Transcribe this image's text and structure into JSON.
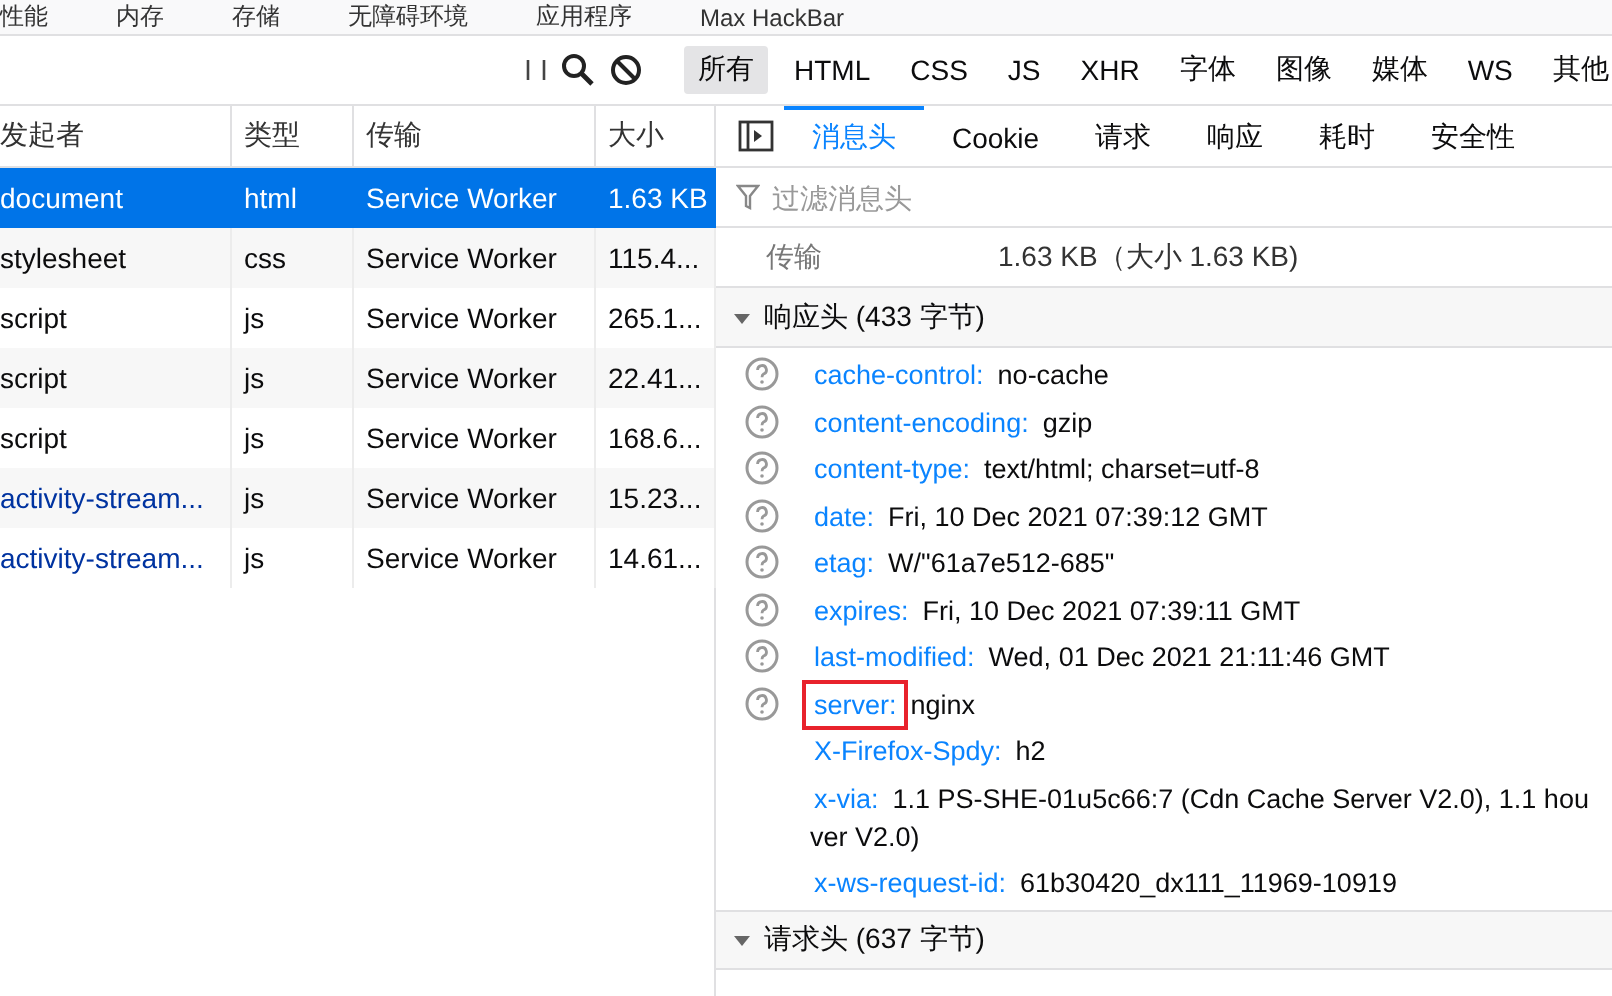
{
  "top_tabs": [
    "性能",
    "内存",
    "存储",
    "无障碍环境",
    "应用程序",
    "Max HackBar"
  ],
  "filter_types": [
    {
      "label": "所有",
      "selected": true
    },
    {
      "label": "HTML",
      "selected": false
    },
    {
      "label": "CSS",
      "selected": false
    },
    {
      "label": "JS",
      "selected": false
    },
    {
      "label": "XHR",
      "selected": false
    },
    {
      "label": "字体",
      "selected": false
    },
    {
      "label": "图像",
      "selected": false
    },
    {
      "label": "媒体",
      "selected": false
    },
    {
      "label": "WS",
      "selected": false
    },
    {
      "label": "其他",
      "selected": false
    }
  ],
  "table": {
    "columns": [
      "发起者",
      "类型",
      "传输",
      "大小"
    ],
    "rows": [
      {
        "cells": [
          "document",
          "html",
          "Service Worker",
          "1.63 KB"
        ],
        "selected": true,
        "link": false
      },
      {
        "cells": [
          "stylesheet",
          "css",
          "Service Worker",
          "115.4..."
        ],
        "selected": false,
        "link": false
      },
      {
        "cells": [
          "script",
          "js",
          "Service Worker",
          "265.1..."
        ],
        "selected": false,
        "link": false
      },
      {
        "cells": [
          "script",
          "js",
          "Service Worker",
          "22.41..."
        ],
        "selected": false,
        "link": false
      },
      {
        "cells": [
          "script",
          "js",
          "Service Worker",
          "168.6..."
        ],
        "selected": false,
        "link": false
      },
      {
        "cells": [
          "activity-stream...",
          "js",
          "Service Worker",
          "15.23..."
        ],
        "selected": false,
        "link": true
      },
      {
        "cells": [
          "activity-stream...",
          "js",
          "Service Worker",
          "14.61..."
        ],
        "selected": false,
        "link": true
      }
    ]
  },
  "details": {
    "tabs": [
      {
        "label": "消息头",
        "selected": true
      },
      {
        "label": "Cookie",
        "selected": false
      },
      {
        "label": "请求",
        "selected": false
      },
      {
        "label": "响应",
        "selected": false
      },
      {
        "label": "耗时",
        "selected": false
      },
      {
        "label": "安全性",
        "selected": false
      }
    ],
    "filter": {
      "placeholder": "过滤消息头"
    },
    "transfer": {
      "label": "传输",
      "value": "1.63 KB（大小 1.63 KB)"
    },
    "response_section": {
      "title": "响应头 (433 字节)",
      "expanded": true,
      "headers": [
        {
          "name": "cache-control:",
          "value": "no-cache",
          "help": true,
          "highlighted": false
        },
        {
          "name": "content-encoding:",
          "value": "gzip",
          "help": true,
          "highlighted": false
        },
        {
          "name": "content-type:",
          "value": "text/html; charset=utf-8",
          "help": true,
          "highlighted": false
        },
        {
          "name": "date:",
          "value": "Fri, 10 Dec 2021 07:39:12 GMT",
          "help": true,
          "highlighted": false
        },
        {
          "name": "etag:",
          "value": "W/\"61a7e512-685\"",
          "help": true,
          "highlighted": false
        },
        {
          "name": "expires:",
          "value": "Fri, 10 Dec 2021 07:39:11 GMT",
          "help": true,
          "highlighted": false
        },
        {
          "name": "last-modified:",
          "value": "Wed, 01 Dec 2021 21:11:46 GMT",
          "help": true,
          "highlighted": false
        },
        {
          "name": "server:",
          "value": "nginx",
          "help": true,
          "highlighted": true
        },
        {
          "name": "X-Firefox-Spdy:",
          "value": "h2",
          "help": false,
          "highlighted": false
        },
        {
          "name": "x-via:",
          "value": "1.1 PS-SHE-01u5c66:7 (Cdn Cache Server V2.0), 1.1 hou",
          "value_line_2": "ver V2.0)",
          "help": false,
          "highlighted": false
        },
        {
          "name": "x-ws-request-id:",
          "value": "61b30420_dx111_11969-10919",
          "help": false,
          "highlighted": false
        }
      ]
    },
    "request_section": {
      "title": "请求头 (637 字节)",
      "expanded": true
    }
  }
}
